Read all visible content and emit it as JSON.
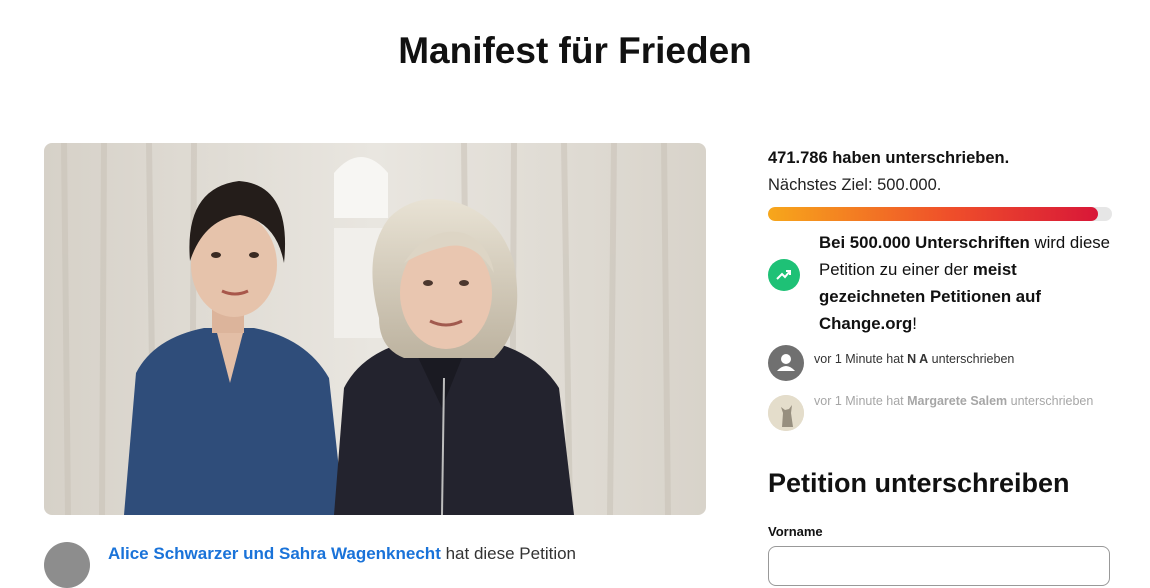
{
  "page": {
    "title": "Manifest für Frieden"
  },
  "hero": {
    "image": "petition-photo-two-women-in-front-of-curtain"
  },
  "creator": {
    "names": "Alice Schwarzer und Sahra Wagenknecht",
    "suffix": " hat diese Petition"
  },
  "stats": {
    "count_text": "471.786 haben unterschrieben.",
    "goal_text": "Nächstes Ziel: 500.000.",
    "signatures": 471786,
    "goal": 500000,
    "progress_fraction": 0.96,
    "gradient_colors": [
      "#f7a71b",
      "#ef4f2a",
      "#d81738"
    ]
  },
  "milestone": {
    "icon": "trending-up-icon",
    "icon_color": "#1ec176",
    "part1_bold": "Bei 500.000 Unterschriften",
    "part2": " wird diese Petition zu einer der ",
    "part3_bold": "meist gezeichneten Petitionen auf Change.org",
    "part4": "!"
  },
  "recent_signers": [
    {
      "prefix": "vor 1 Minute hat ",
      "name": "N A",
      "suffix": " unterschrieben",
      "avatar": "default-user-icon"
    },
    {
      "prefix": "vor 1 Minute hat ",
      "name": "Margarete Salem",
      "suffix": " unterschrieben",
      "avatar": "cat-photo-avatar"
    }
  ],
  "sign_form": {
    "heading": "Petition unterschreiben",
    "first_name_label": "Vorname",
    "first_name_value": ""
  }
}
